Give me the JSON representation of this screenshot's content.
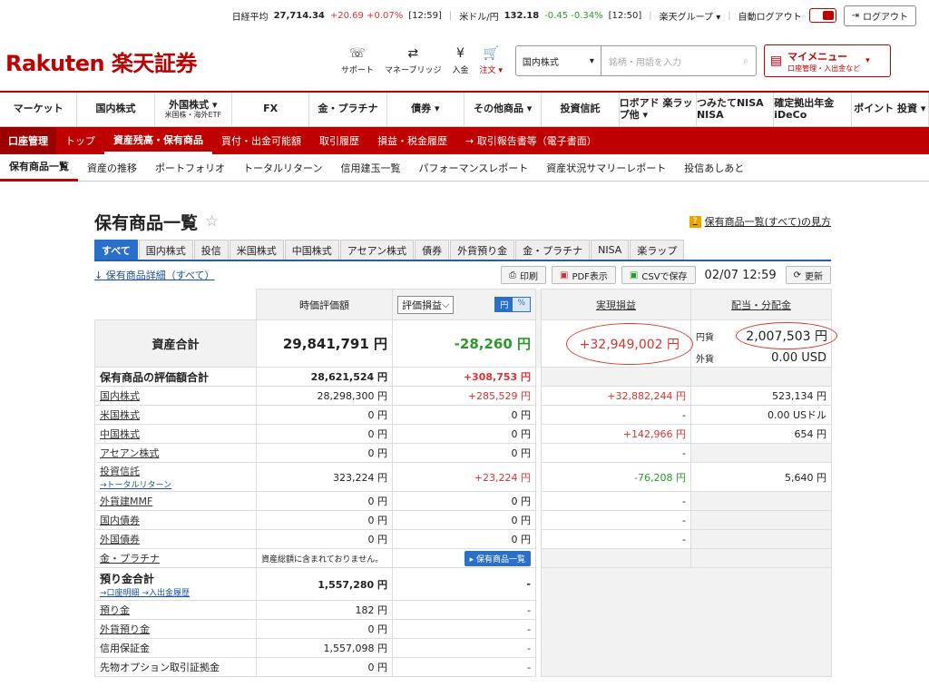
{
  "topbar": {
    "nikkei_label": "日経平均",
    "nikkei_value": "27,714.34",
    "nikkei_change": "+20.69 +0.07%",
    "nikkei_time": "[12:59]",
    "usd_label": "米ドル/円",
    "usd_value": "132.18",
    "usd_change": "-0.45 -0.34%",
    "usd_time": "[12:50]",
    "group_label": "楽天グループ ▾",
    "autologout_label": "自動ログアウト",
    "logout_label": "ログアウト"
  },
  "header": {
    "logo": "Rakuten 楽天証券",
    "icons": [
      {
        "sym": "☏",
        "label": "サポート"
      },
      {
        "sym": "⇄",
        "label": "マネーブリッジ"
      },
      {
        "sym": "¥",
        "label": "入金"
      },
      {
        "sym": "🛒",
        "label": "注文 ▾"
      }
    ],
    "search_select": "国内株式",
    "search_placeholder": "銘柄・用語を入力",
    "mymenu_title": "マイメニュー",
    "mymenu_sub": "口座管理・入出金など"
  },
  "gnav": [
    {
      "label": "マーケット",
      "sub": ""
    },
    {
      "label": "国内株式",
      "sub": ""
    },
    {
      "label": "外国株式 ▾",
      "sub": "米国株・海外ETF"
    },
    {
      "label": "FX",
      "sub": ""
    },
    {
      "label": "金・プラチナ",
      "sub": ""
    },
    {
      "label": "債券 ▾",
      "sub": ""
    },
    {
      "label": "その他商品 ▾",
      "sub": ""
    },
    {
      "label": "投資信託",
      "sub": ""
    },
    {
      "label": "ロボアド 楽ラップ他 ▾",
      "sub": ""
    },
    {
      "label": "つみたてNISA NISA",
      "sub": ""
    },
    {
      "label": "確定拠出年金 iDeCo",
      "sub": ""
    },
    {
      "label": "ポイント 投資 ▾",
      "sub": ""
    }
  ],
  "subnav": {
    "section": "口座管理",
    "items": [
      "トップ",
      "資産残高・保有商品",
      "買付・出金可能額",
      "取引履歴",
      "損益・税金履歴",
      "→ 取引報告書等（電子書面）"
    ]
  },
  "tnav": [
    "保有商品一覧",
    "資産の推移",
    "ポートフォリオ",
    "トータルリターン",
    "信用建玉一覧",
    "パフォーマンスレポート",
    "資産状況サマリーレポート",
    "投信あしあと"
  ],
  "page": {
    "title": "保有商品一覧",
    "help": "保有商品一覧(すべて)の見方",
    "tabs": [
      "すべて",
      "国内株式",
      "投信",
      "米国株式",
      "中国株式",
      "アセアン株式",
      "債券",
      "外貨預り金",
      "金・プラチナ",
      "NISA",
      "楽ラップ"
    ],
    "detail_link": "↓ 保有商品詳細（すべて）",
    "print": "印刷",
    "pdf": "PDF表示",
    "csv": "CSVで保存",
    "datetime": "02/07 12:59",
    "refresh": "更新"
  },
  "table": {
    "col_value": "時価評価額",
    "col_pl_select": "評価損益",
    "unit_yen": "円",
    "unit_pct": "%",
    "col_realized": "実現損益",
    "col_dividend": "配当・分配金",
    "total_label": "資産合計",
    "total_value": "29,841,791 円",
    "total_pl": "-28,260 円",
    "total_realized": "+32,949,002 円",
    "div_yen_label": "円貨",
    "div_yen": "2,007,503 円",
    "div_fx_label": "外貨",
    "div_fx": "0.00 USD",
    "rows": [
      {
        "label": "保有商品の評価額合計",
        "value": "28,621,524 円",
        "pl": "+308,753 円",
        "realized": "",
        "dividend": "",
        "bold": true
      },
      {
        "label": "国内株式",
        "value": "28,298,300 円",
        "pl": "+285,529 円",
        "realized": "+32,882,244 円",
        "dividend": "523,134 円"
      },
      {
        "label": "米国株式",
        "value": "0 円",
        "pl": "0 円",
        "realized": "-",
        "dividend": "0.00 USドル"
      },
      {
        "label": "中国株式",
        "value": "0 円",
        "pl": "0 円",
        "realized": "+142,966 円",
        "dividend": "654 円"
      },
      {
        "label": "アセアン株式",
        "value": "0 円",
        "pl": "0 円",
        "realized": "-",
        "dividend": ""
      },
      {
        "label": "投資信託",
        "sub": "→トータルリターン",
        "value": "323,224 円",
        "pl": "+23,224 円",
        "realized": "-76,208 円",
        "dividend": "5,640 円"
      },
      {
        "label": "外貨建MMF",
        "value": "0 円",
        "pl": "0 円",
        "realized": "-",
        "dividend": ""
      },
      {
        "label": "国内債券",
        "value": "0 円",
        "pl": "0 円",
        "realized": "-",
        "dividend": ""
      },
      {
        "label": "外国債券",
        "value": "0 円",
        "pl": "0 円",
        "realized": "-",
        "dividend": ""
      },
      {
        "label": "金・プラチナ",
        "value": "資産総額に含まれておりません。",
        "pl": "▸ 保有商品一覧",
        "realized": "",
        "dividend": ""
      }
    ],
    "deposit_label": "預り金合計",
    "deposit_sub": "→口座明細 →入出金履歴",
    "deposit_value": "1,557,280 円",
    "deposit_pl": "-",
    "deposit_rows": [
      {
        "label": "預り金",
        "value": "182 円",
        "pl": "-"
      },
      {
        "label": "外貨預り金",
        "value": "0 円",
        "pl": "-"
      },
      {
        "label": "信用保証金",
        "value": "1,557,098 円",
        "pl": "-"
      },
      {
        "label": "先物オプション取引証拠金",
        "value": "0 円",
        "pl": "-"
      }
    ]
  }
}
